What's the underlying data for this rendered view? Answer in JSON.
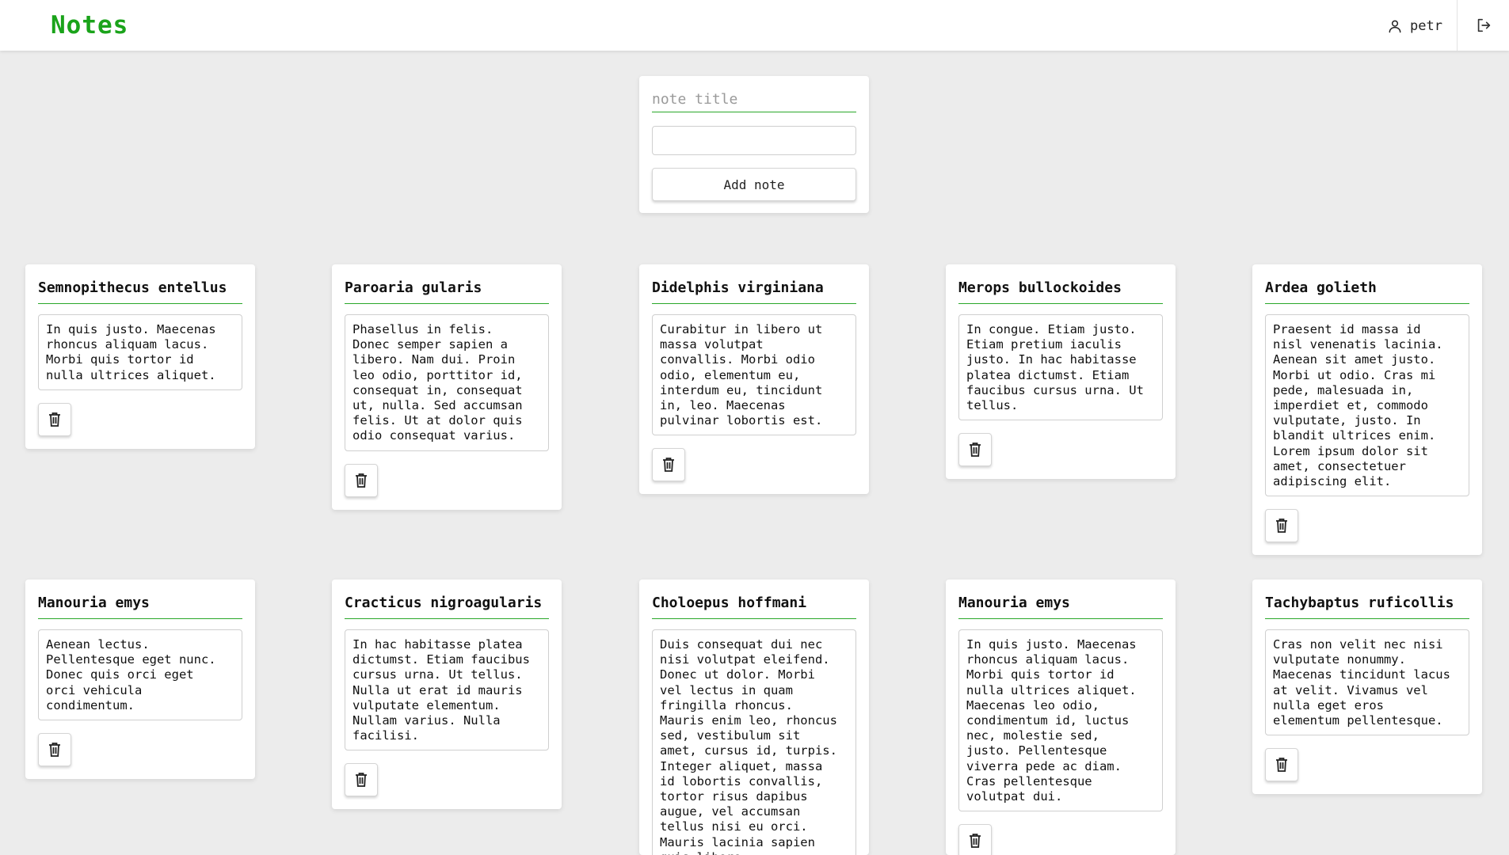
{
  "app": {
    "title": "Notes"
  },
  "header": {
    "username": "petr",
    "user_icon": "user-icon",
    "logout_icon": "logout-icon"
  },
  "composer": {
    "title_placeholder": "note title",
    "body_value": "",
    "add_label": "Add note"
  },
  "notes": [
    {
      "title": "Semnopithecus entellus",
      "body": "In quis justo. Maecenas\nrhoncus aliquam lacus.\nMorbi quis tortor id\nnulla ultrices aliquet."
    },
    {
      "title": "Paroaria gularis",
      "body": "Phasellus in felis.\nDonec semper sapien a\nlibero. Nam dui. Proin\nleo odio, porttitor id,\nconsequat in, consequat\nut, nulla. Sed accumsan\nfelis. Ut at dolor quis\nodio consequat varius."
    },
    {
      "title": "Didelphis virginiana",
      "body": "Curabitur in libero ut\nmassa volutpat\nconvallis. Morbi odio\nodio, elementum eu,\ninterdum eu, tincidunt\nin, leo. Maecenas\npulvinar lobortis est."
    },
    {
      "title": "Merops bullockoides",
      "body": "In congue. Etiam justo.\nEtiam pretium iaculis\njusto. In hac habitasse\nplatea dictumst. Etiam\nfaucibus cursus urna. Ut\ntellus."
    },
    {
      "title": "Ardea golieth",
      "body": "Praesent id massa id\nnisl venenatis lacinia.\nAenean sit amet justo.\nMorbi ut odio. Cras mi\npede, malesuada in,\nimperdiet et, commodo\nvulputate, justo. In\nblandit ultrices enim.\nLorem ipsum dolor sit\namet, consectetuer\nadipiscing elit."
    },
    {
      "title": "Manouria emys",
      "body": "Aenean lectus.\nPellentesque eget nunc.\nDonec quis orci eget\norci vehicula\ncondimentum."
    },
    {
      "title": "Cracticus nigroagularis",
      "body": "In hac habitasse platea\ndictumst. Etiam faucibus\ncursus urna. Ut tellus.\nNulla ut erat id mauris\nvulputate elementum.\nNullam varius. Nulla\nfacilisi."
    },
    {
      "title": "Choloepus hoffmani",
      "body": "Duis consequat dui nec\nnisi volutpat eleifend.\nDonec ut dolor. Morbi\nvel lectus in quam\nfringilla rhoncus.\nMauris enim leo, rhoncus\nsed, vestibulum sit\namet, cursus id, turpis.\nInteger aliquet, massa\nid lobortis convallis,\ntortor risus dapibus\naugue, vel accumsan\ntellus nisi eu orci.\nMauris lacinia sapien\nquis libero."
    },
    {
      "title": "Manouria emys",
      "body": "In quis justo. Maecenas\nrhoncus aliquam lacus.\nMorbi quis tortor id\nnulla ultrices aliquet.\nMaecenas leo odio,\ncondimentum id, luctus\nnec, molestie sed,\njusto. Pellentesque\nviverra pede ac diam.\nCras pellentesque\nvolutpat dui."
    },
    {
      "title": "Tachybaptus ruficollis",
      "body": "Cras non velit nec nisi\nvulputate nonummy.\nMaecenas tincidunt lacus\nat velit. Vivamus vel\nnulla eget eros\nelementum pellentesque."
    }
  ]
}
